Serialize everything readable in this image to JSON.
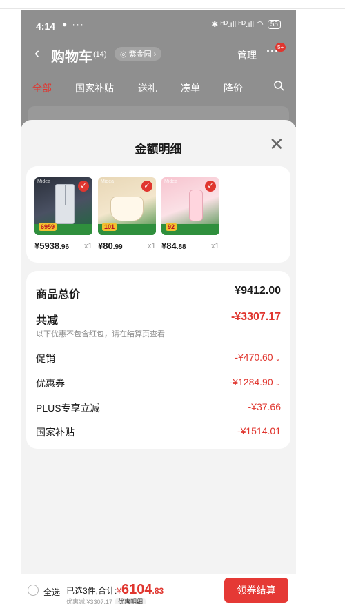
{
  "status_bar": {
    "time": "4:14",
    "dots": "● ···",
    "signal": "✱ ᴴᴰ.ıll ᴴᴰ.ıll ◠",
    "battery": "55"
  },
  "header": {
    "back_icon": "‹",
    "title": "购物车",
    "count": "(14)",
    "location": "◎ 紫金园 ›",
    "manage": "管理",
    "more_icon": "···",
    "badge": "5+"
  },
  "tabs": [
    "全部",
    "国家补贴",
    "送礼",
    "凑单",
    "降价"
  ],
  "sheet": {
    "title": "金额明细",
    "close_icon": "✕",
    "products": [
      {
        "price_main": "¥5938",
        "price_dec": ".96",
        "qty": "x1",
        "tag": "6959",
        "brand": "Midea"
      },
      {
        "price_main": "¥80",
        "price_dec": ".99",
        "qty": "x1",
        "tag": "101",
        "brand": "Midea"
      },
      {
        "price_main": "¥84",
        "price_dec": ".88",
        "qty": "x1",
        "tag": "92",
        "brand": "Midea"
      }
    ],
    "breakdown": {
      "total_label": "商品总价",
      "total_value": "¥9412.00",
      "reduce_label": "共减",
      "reduce_value": "-¥3307.17",
      "note": "以下优惠不包含红包，请在结算页查看",
      "items": [
        {
          "label": "促销",
          "value": "-¥470.60",
          "chevron": "⌄"
        },
        {
          "label": "优惠券",
          "value": "-¥1284.90",
          "chevron": "⌄"
        },
        {
          "label": "PLUS专享立减",
          "value": "-¥37.66",
          "chevron": ""
        },
        {
          "label": "国家补贴",
          "value": "-¥1514.01",
          "chevron": ""
        }
      ]
    }
  },
  "bottom_bar": {
    "select_all": "全选",
    "selected_text": "已选3件,合计:",
    "currency": "¥",
    "total_main": "6104",
    "total_dec": ".83",
    "discount_text": "优惠减:¥3307.17",
    "discount_chip": "优惠明细",
    "checkout": "领券结算"
  },
  "colors": {
    "accent": "#e0362f",
    "checkout_bg": "#e53935",
    "overlay": "#8f8f8f"
  }
}
